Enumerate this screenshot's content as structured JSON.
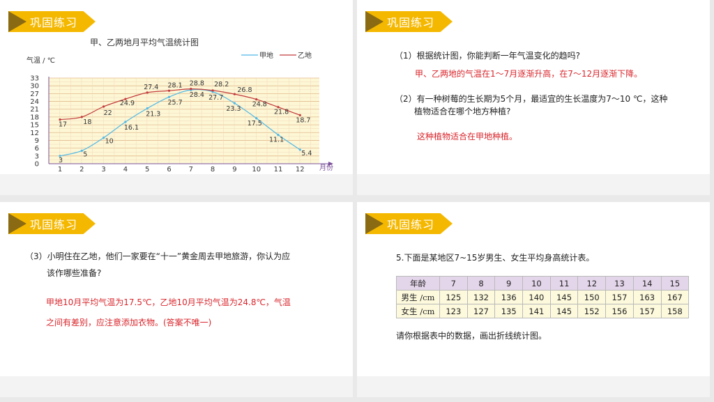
{
  "banner_label": "巩固练习",
  "slide1": {
    "chart_data": {
      "type": "line",
      "title": "甲、乙两地月平均气温统计图",
      "ylabel": "气温 / ℃",
      "xlabel": "月份",
      "categories": [
        "1",
        "2",
        "3",
        "4",
        "5",
        "6",
        "7",
        "8",
        "9",
        "10",
        "11",
        "12"
      ],
      "yticks": [
        "0",
        "3",
        "6",
        "9",
        "12",
        "15",
        "18",
        "21",
        "24",
        "27",
        "30",
        "33"
      ],
      "ylim": [
        0,
        33
      ],
      "grid": true,
      "legend_position": "top-right",
      "series": [
        {
          "name": "甲地",
          "color": "#4fb8e6",
          "values": [
            3,
            5,
            10,
            16.1,
            21.3,
            25.7,
            28.4,
            27.7,
            23.3,
            17.5,
            11.1,
            5.4
          ]
        },
        {
          "name": "乙地",
          "color": "#c23b3b",
          "values": [
            17,
            18,
            22,
            24.9,
            27.4,
            28.1,
            28.8,
            28.2,
            26.8,
            24.8,
            21.8,
            18.7
          ]
        }
      ]
    }
  },
  "slide2": {
    "q1": "（1）根据统计图，你能判断一年气温变化的趋吗?",
    "a1": "甲、乙两地的气温在1～7月逐渐升高，在7～12月逐渐下降。",
    "q2_line1": "（2）有一种树莓的生长期为5个月，最适宜的生长温度为7～10 ℃，这种",
    "q2_line2": "植物适合在哪个地方种植?",
    "a2": "这种植物适合在甲地种植。"
  },
  "slide3": {
    "q3_line1": "（3）小明住在乙地，他们一家要在“十一”黄金周去甲地旅游，你认为应",
    "q3_line2": "该作哪些准备?",
    "a3_line1": "甲地10月平均气温为17.5℃，乙地10月平均气温为24.8℃，气温",
    "a3_line2": "之间有差别，应注意添加衣物。(答案不唯一)"
  },
  "slide4": {
    "intro": "5.下面是某地区7~15岁男生、女生平均身高统计表。",
    "table": {
      "header": [
        "年龄",
        "7",
        "8",
        "9",
        "10",
        "11",
        "12",
        "13",
        "14",
        "15"
      ],
      "rows": [
        [
          "男生 /cm",
          "125",
          "132",
          "136",
          "140",
          "145",
          "150",
          "157",
          "163",
          "167"
        ],
        [
          "女生 /cm",
          "123",
          "127",
          "135",
          "141",
          "145",
          "152",
          "156",
          "157",
          "158"
        ]
      ]
    },
    "instruction": "请你根据表中的数据，画出折线统计图。"
  }
}
